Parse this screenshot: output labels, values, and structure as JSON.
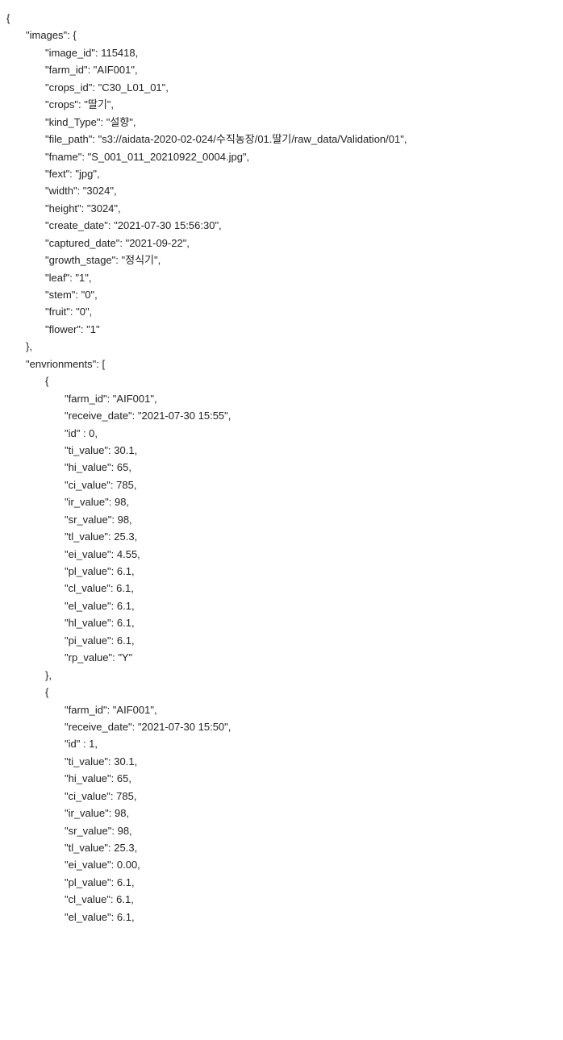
{
  "l0": "{",
  "l1": "\"images\": {",
  "l2": "\"image_id\": 115418,",
  "l3": "\"farm_id\": \"AIF001\",",
  "l4": "\"crops_id\": \"C30_L01_01\",",
  "l5": "\"crops\": \"딸기\",",
  "l6": "\"kind_Type\": \"설향\",",
  "l7": "\"file_path\": \"s3://aidata-2020-02-024/수직농장/01.딸기/raw_data/Validation/01\",",
  "l8": "\"fname\": \"S_001_011_20210922_0004.jpg\",",
  "l9": "\"fext\": \"jpg\",",
  "l10": "\"width\": \"3024\",",
  "l11": "\"height\": \"3024\",",
  "l12": "\"create_date\": \"2021-07-30 15:56:30\",",
  "l13": "\"captured_date\": \"2021-09-22\",",
  "l14": "\"growth_stage\": \"정식기\",",
  "l15": "\"leaf\": \"1\",",
  "l16": "\"stem\": \"0\",",
  "l17": "\"fruit\": \"0\",",
  "l18": "\"flower\": \"1\"",
  "l19": "},",
  "l20": "\"envrionments\": [",
  "l21": "{",
  "l22": "\"farm_id\": \"AIF001\",",
  "l23": "\"receive_date\": \"2021-07-30 15:55\",",
  "l24": "\"id\" : 0,",
  "l25": "\"ti_value\": 30.1,",
  "l26": "\"hi_value\": 65,",
  "l27": "\"ci_value\": 785,",
  "l28": "\"ir_value\": 98,",
  "l29": "\"sr_value\": 98,",
  "l30": "\"tl_value\": 25.3,",
  "l31": "\"ei_value\": 4.55,",
  "l32": "\"pl_value\": 6.1,",
  "l33": "\"cl_value\": 6.1,",
  "l34": "\"el_value\": 6.1,",
  "l35": "\"hl_value\": 6.1,",
  "l36": "\"pi_value\": 6.1,",
  "l37": "\"rp_value\": \"Y\"",
  "l38": "},",
  "l39": "{",
  "l40": "\"farm_id\": \"AIF001\",",
  "l41": "\"receive_date\": \"2021-07-30 15:50\",",
  "l42": "\"id\" : 1,",
  "l43": "\"ti_value\": 30.1,",
  "l44": "\"hi_value\": 65,",
  "l45": "\"ci_value\": 785,",
  "l46": "\"ir_value\": 98,",
  "l47": "\"sr_value\": 98,",
  "l48": "\"tl_value\": 25.3,",
  "l49": "\"ei_value\": 0.00,",
  "l50": "\"pl_value\": 6.1,",
  "l51": "\"cl_value\": 6.1,",
  "l52": "\"el_value\": 6.1,"
}
